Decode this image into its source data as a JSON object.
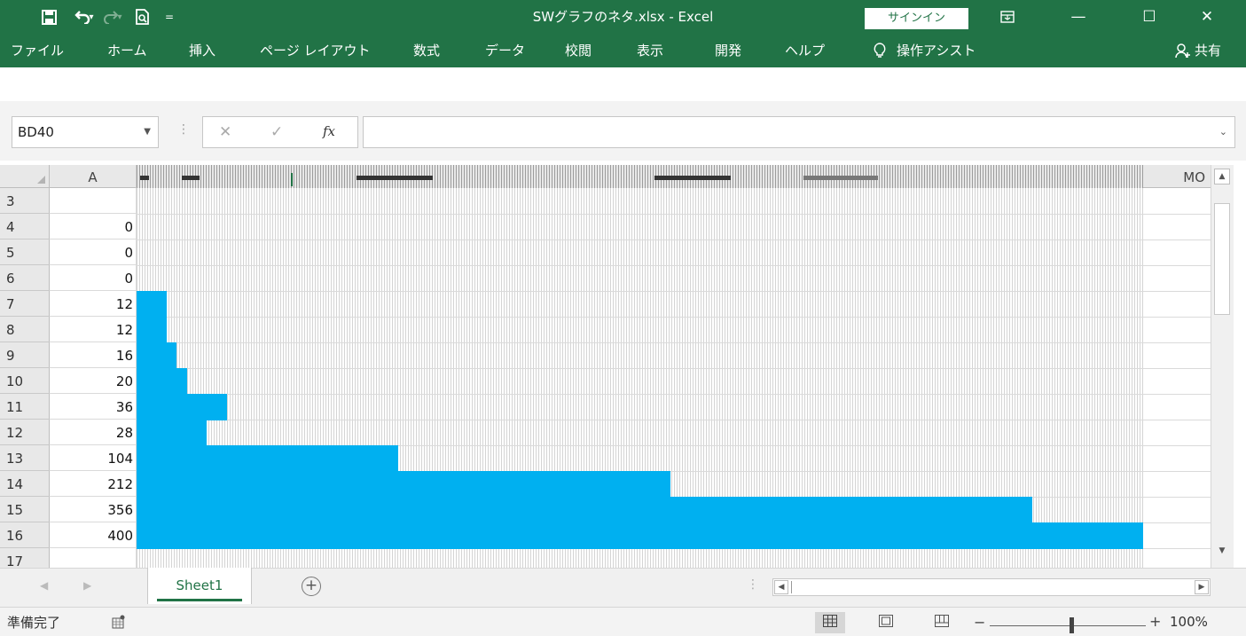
{
  "window": {
    "title": "SWグラフのネタ.xlsx  -  Excel",
    "signin_label": "サインイン",
    "minimize": "—",
    "maximize": "☐",
    "close": "✕"
  },
  "qat": {
    "save_icon": "save-icon",
    "undo_icon": "undo-icon",
    "redo_icon": "redo-icon",
    "print_preview_icon": "print-preview-icon",
    "customize_icon": "customize-icon"
  },
  "ribbon_tabs": [
    "ファイル",
    "ホーム",
    "挿入",
    "ページ レイアウト",
    "数式",
    "データ",
    "校閲",
    "表示",
    "開発",
    "ヘルプ"
  ],
  "tell_me": "操作アシスト",
  "share_label": "共有",
  "formula_bar": {
    "name_box": "BD40",
    "fx": "fx",
    "cancel": "✕",
    "enter": "✓",
    "content": ""
  },
  "grid": {
    "col_a_header": "A",
    "last_col_header": "MO",
    "rows": [
      {
        "row": "3",
        "a": ""
      },
      {
        "row": "4",
        "a": "0"
      },
      {
        "row": "5",
        "a": "0"
      },
      {
        "row": "6",
        "a": "0"
      },
      {
        "row": "7",
        "a": "12"
      },
      {
        "row": "8",
        "a": "12"
      },
      {
        "row": "9",
        "a": "16"
      },
      {
        "row": "10",
        "a": "20"
      },
      {
        "row": "11",
        "a": "36"
      },
      {
        "row": "12",
        "a": "28"
      },
      {
        "row": "13",
        "a": "104"
      },
      {
        "row": "14",
        "a": "212"
      },
      {
        "row": "15",
        "a": "356"
      },
      {
        "row": "16",
        "a": "400"
      },
      {
        "row": "17",
        "a": ""
      }
    ],
    "fill_color": "#00b0f0"
  },
  "sheet_tabs": [
    "Sheet1"
  ],
  "status_bar": {
    "ready": "準備完了",
    "zoom": "100%"
  },
  "colors": {
    "accent": "#217346",
    "bar_fill": "#00b0f0"
  }
}
